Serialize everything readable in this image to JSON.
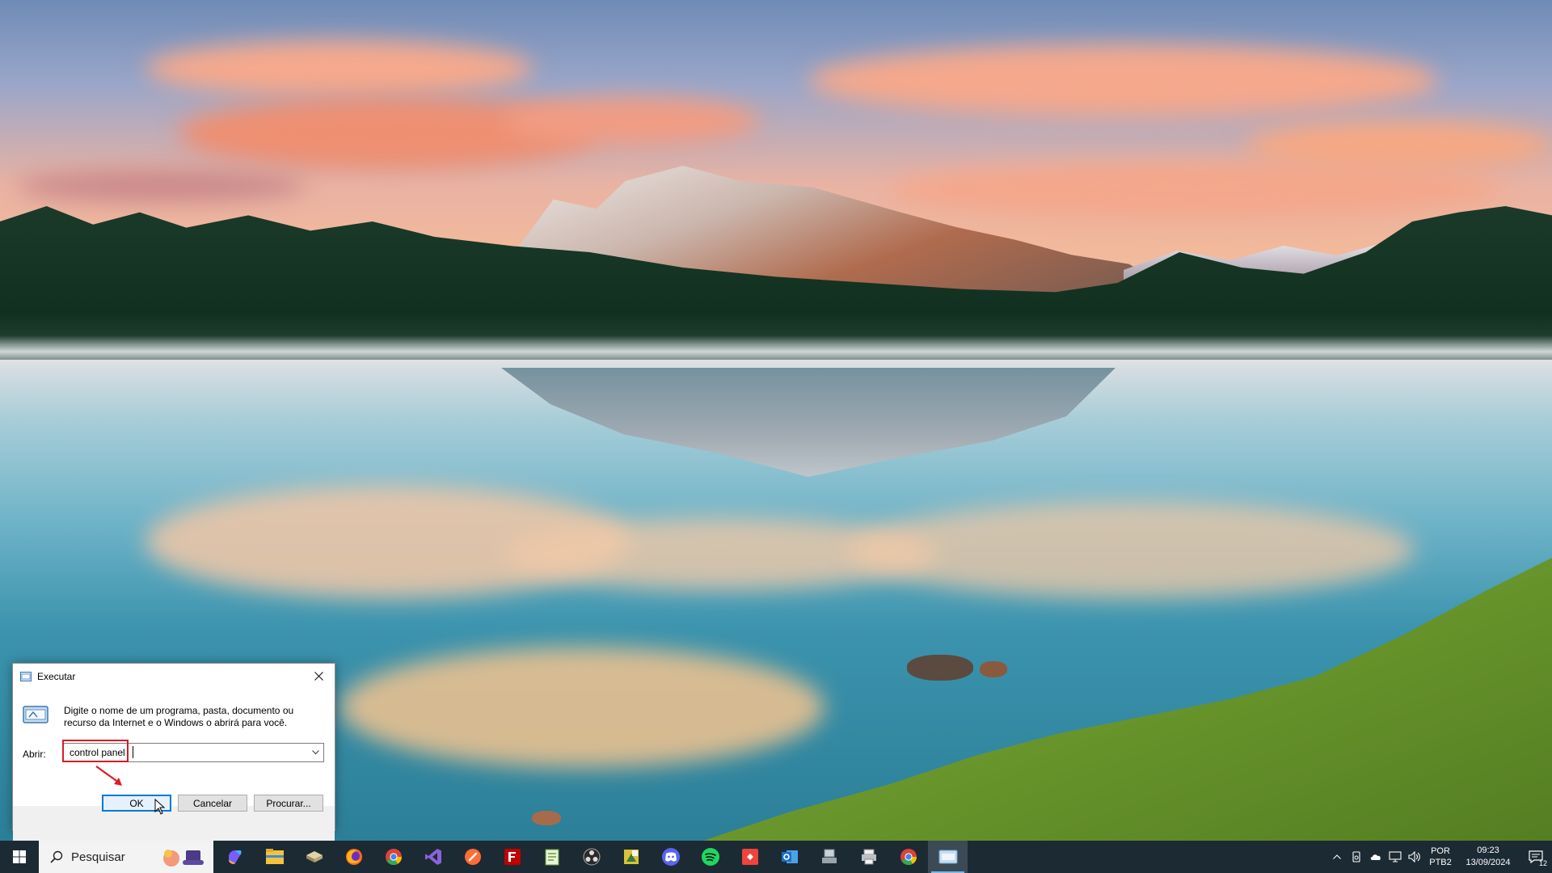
{
  "run_dialog": {
    "title": "Executar",
    "description": "Digite o nome de um programa, pasta, documento ou recurso da Internet e o Windows o abrirá para você.",
    "open_label": "Abrir:",
    "open_value": "control panel",
    "ok_label": "OK",
    "cancel_label": "Cancelar",
    "browse_label": "Procurar..."
  },
  "taskbar": {
    "search_placeholder": "Pesquisar",
    "apps": [
      {
        "name": "copilot-icon",
        "color": "#7c5cff"
      },
      {
        "name": "file-explorer-icon",
        "color": "#f4c33d"
      },
      {
        "name": "app-icon",
        "color": "#c8b48a"
      },
      {
        "name": "firefox-icon",
        "color": "#ff6a1a"
      },
      {
        "name": "chrome-icon",
        "color": "#34a853"
      },
      {
        "name": "visual-studio-icon",
        "color": "#8b63d8"
      },
      {
        "name": "postman-icon",
        "color": "#ff6c37"
      },
      {
        "name": "filezilla-icon",
        "color": "#bf0000"
      },
      {
        "name": "notepad-plus-icon",
        "color": "#8fc46a"
      },
      {
        "name": "obs-icon",
        "color": "#444"
      },
      {
        "name": "sticky-app-icon",
        "color": "#d8c23a"
      },
      {
        "name": "discord-icon",
        "color": "#5865f2"
      },
      {
        "name": "spotify-icon",
        "color": "#1ed760"
      },
      {
        "name": "anydesk-icon",
        "color": "#ef443b"
      },
      {
        "name": "outlook-icon",
        "color": "#1a6fc9"
      },
      {
        "name": "network-app-icon",
        "color": "#9aa3ab"
      },
      {
        "name": "printer-app-icon",
        "color": "#9aa3ab"
      },
      {
        "name": "chrome-icon",
        "color": "#34a853"
      },
      {
        "name": "run-icon",
        "color": "#6aa6d8"
      }
    ],
    "tray": {
      "language_line1": "POR",
      "language_line2": "PTB2",
      "time": "09:23",
      "date": "13/09/2024",
      "notification_count": "12"
    }
  }
}
